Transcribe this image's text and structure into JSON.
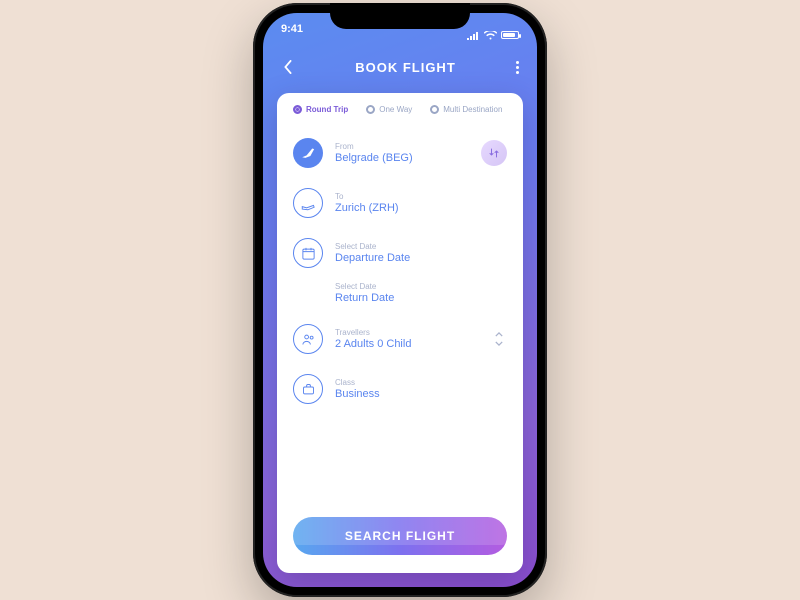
{
  "status": {
    "time": "9:41"
  },
  "header": {
    "title": "BOOK FLIGHT"
  },
  "trip_types": {
    "round_trip": "Round Trip",
    "one_way": "One Way",
    "multi": "Multi Destination"
  },
  "form": {
    "from": {
      "label": "From",
      "value": "Belgrade (BEG)"
    },
    "to": {
      "label": "To",
      "value": "Zurich (ZRH)"
    },
    "depart": {
      "label": "Select Date",
      "value": "Departure Date"
    },
    "return": {
      "label": "Select Date",
      "value": "Return Date"
    },
    "travellers": {
      "label": "Travellers",
      "value": "2 Adults   0 Child"
    },
    "class": {
      "label": "Class",
      "value": "Business"
    }
  },
  "search_label": "SEARCH FLIGHT"
}
